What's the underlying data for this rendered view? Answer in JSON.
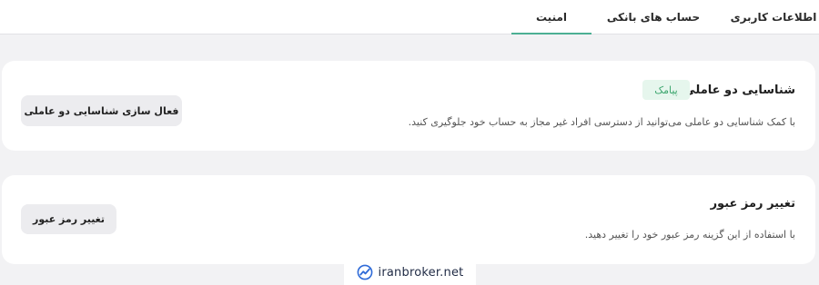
{
  "tabs": [
    {
      "label": "اطلاعات کاربری"
    },
    {
      "label": "حساب های بانکی"
    },
    {
      "label": "امنیت",
      "active": true
    }
  ],
  "accent_color": "#4caf93",
  "two_factor": {
    "title": "شناسایی دو عاملی",
    "badge": "پیامک",
    "description": "با کمک شناسایی دو عاملی می‌توانید از دسترسی افراد غیر مجاز به حساب خود جلوگیری کنید.",
    "button_label": "فعال سازی شناسایی دو عاملی"
  },
  "password": {
    "title": "تغییر رمز عبور",
    "description": "با استفاده از این گزینه رمز عبور خود را تغییر دهید.",
    "button_label": "تغییر رمز عبور"
  },
  "watermark": {
    "text": "iranbroker.net",
    "icon": "trend-line-logo-icon"
  }
}
